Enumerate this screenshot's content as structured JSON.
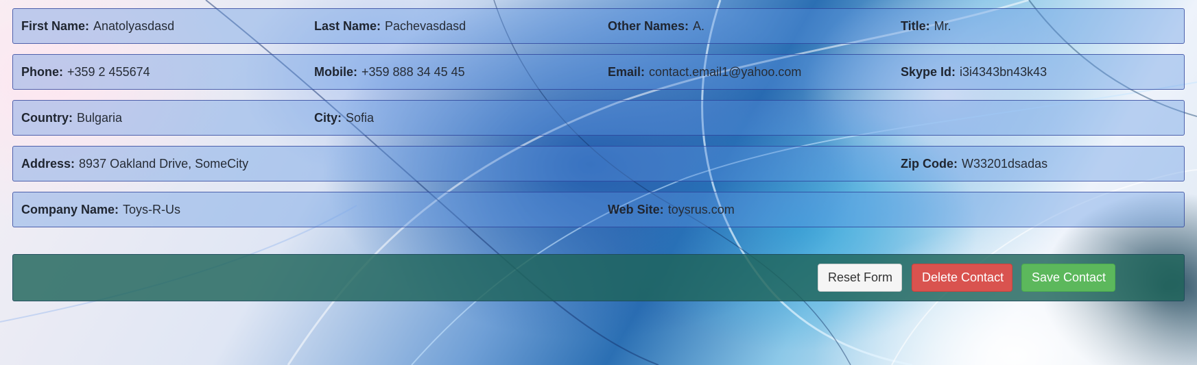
{
  "contact": {
    "first_name": {
      "label": "First Name:",
      "value": "Anatolyasdasd"
    },
    "last_name": {
      "label": "Last Name:",
      "value": "Pachevasdasd"
    },
    "other_names": {
      "label": "Other Names:",
      "value": "A."
    },
    "title": {
      "label": "Title:",
      "value": "Mr."
    },
    "phone": {
      "label": "Phone:",
      "value": "+359 2 455674"
    },
    "mobile": {
      "label": "Mobile:",
      "value": "+359 888 34 45 45"
    },
    "email": {
      "label": "Email:",
      "value": "contact.email1@yahoo.com"
    },
    "skype": {
      "label": "Skype Id:",
      "value": "i3i4343bn43k43"
    },
    "country": {
      "label": "Country:",
      "value": "Bulgaria"
    },
    "city": {
      "label": "City:",
      "value": "Sofia"
    },
    "address": {
      "label": "Address:",
      "value": "8937 Oakland Drive, SomeCity"
    },
    "zip": {
      "label": "Zip Code:",
      "value": "W33201dsadas"
    },
    "company": {
      "label": "Company Name:",
      "value": "Toys-R-Us"
    },
    "website": {
      "label": "Web Site:",
      "value": "toysrus.com"
    }
  },
  "actions": {
    "reset_label": "Reset Form",
    "delete_label": "Delete Contact",
    "save_label": "Save Contact"
  },
  "colors": {
    "row_bg": "#5f96e1",
    "row_border": "#283c96",
    "actions_bg": "#1e645a",
    "reset_btn": "#f5f5f5",
    "delete_btn": "#d9534f",
    "save_btn": "#5cb85c"
  }
}
